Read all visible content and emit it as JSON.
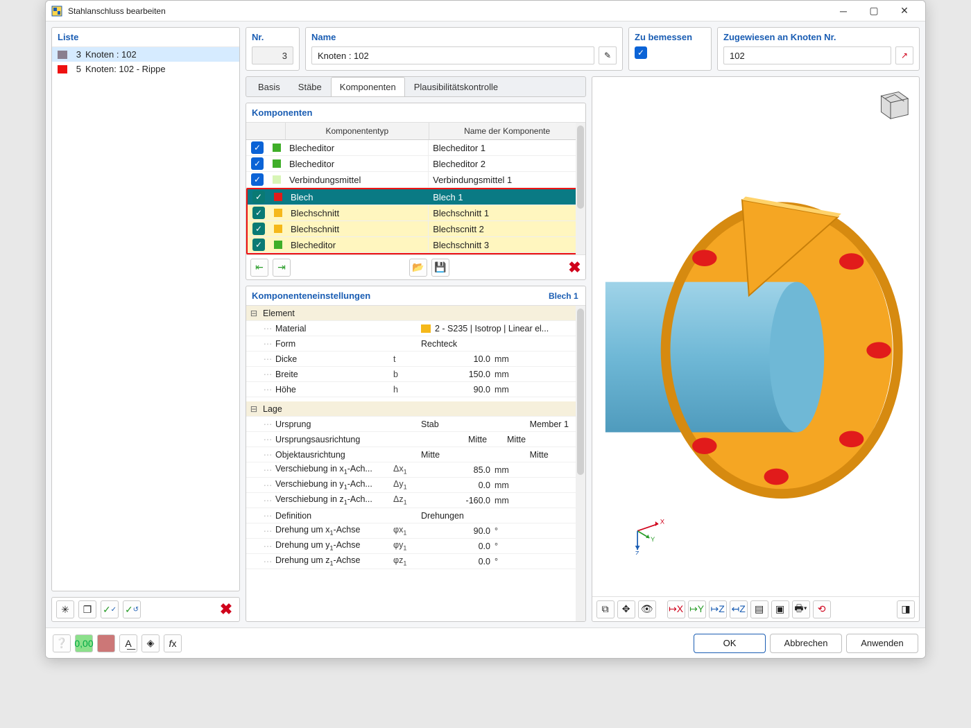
{
  "window": {
    "title": "Stahlanschluss bearbeiten"
  },
  "liste": {
    "title": "Liste",
    "items": [
      {
        "num": "3",
        "label": "Knoten : 102",
        "color": "#8a7f8f",
        "selected": true
      },
      {
        "num": "5",
        "label": "Knoten: 102 - Rippe",
        "color": "#e11",
        "selected": false
      }
    ]
  },
  "header": {
    "nr": {
      "title": "Nr.",
      "value": "3"
    },
    "name": {
      "title": "Name",
      "value": "Knoten : 102"
    },
    "zubemessen": {
      "title": "Zu bemessen",
      "checked": true
    },
    "zugewiesen": {
      "title": "Zugewiesen an Knoten Nr.",
      "value": "102"
    }
  },
  "tabs": [
    {
      "label": "Basis",
      "active": false
    },
    {
      "label": "Stäbe",
      "active": false
    },
    {
      "label": "Komponenten",
      "active": true
    },
    {
      "label": "Plausibilitätskontrolle",
      "active": false
    }
  ],
  "komponenten": {
    "title": "Komponenten",
    "headers": {
      "type": "Komponententyp",
      "name": "Name der Komponente"
    },
    "rows": [
      {
        "chk": "blue",
        "color": "#3fae29",
        "type": "Blecheditor",
        "name": "Blecheditor 1",
        "hl": false,
        "sel": false
      },
      {
        "chk": "blue",
        "color": "#3fae29",
        "type": "Blecheditor",
        "name": "Blecheditor 2",
        "hl": false,
        "sel": false
      },
      {
        "chk": "blue",
        "color": "#d8f5b6",
        "type": "Verbindungsmittel",
        "name": "Verbindungsmittel 1",
        "hl": false,
        "sel": false
      },
      {
        "chk": "teal",
        "color": "#e11b1b",
        "type": "Blech",
        "name": "Blech 1",
        "hl": true,
        "sel": true
      },
      {
        "chk": "teal",
        "color": "#f5b81a",
        "type": "Blechschnitt",
        "name": "Blechschnitt 1",
        "hl": true,
        "sel": false
      },
      {
        "chk": "teal",
        "color": "#f5b81a",
        "type": "Blechschnitt",
        "name": "Blechscnitt 2",
        "hl": true,
        "sel": false
      },
      {
        "chk": "teal",
        "color": "#3fae29",
        "type": "Blecheditor",
        "name": "Blechschnitt 3",
        "hl": true,
        "sel": false
      }
    ]
  },
  "settings": {
    "title": "Komponenteneinstellungen",
    "selected": "Blech 1",
    "groups": [
      {
        "label": "Element",
        "rows": [
          {
            "label": "Material",
            "sym": "",
            "val_text": "2 - S235 | Isotrop | Linear el...",
            "swatch": "#f5b81a"
          },
          {
            "label": "Form",
            "sym": "",
            "val_text": "Rechteck"
          },
          {
            "label": "Dicke",
            "sym": "t",
            "val": "10.0",
            "unit": "mm"
          },
          {
            "label": "Breite",
            "sym": "b",
            "val": "150.0",
            "unit": "mm"
          },
          {
            "label": "Höhe",
            "sym": "h",
            "val": "90.0",
            "unit": "mm"
          }
        ]
      },
      {
        "label": "Lage",
        "rows": [
          {
            "label": "Ursprung",
            "sym": "",
            "val_text": "Stab",
            "extra": "Member 1"
          },
          {
            "label": "Ursprungsausrichtung",
            "sym": "",
            "mid": "Mitte",
            "right": "Mitte"
          },
          {
            "label": "Objektausrichtung",
            "sym": "",
            "val_text": "Mitte",
            "extra": "Mitte"
          },
          {
            "label": "Verschiebung in x₁-Ach...",
            "sym": "Δx₁",
            "val": "85.0",
            "unit": "mm"
          },
          {
            "label": "Verschiebung in y₁-Ach...",
            "sym": "Δy₁",
            "val": "0.0",
            "unit": "mm"
          },
          {
            "label": "Verschiebung in z₁-Ach...",
            "sym": "Δz₁",
            "val": "-160.0",
            "unit": "mm"
          },
          {
            "label": "Definition",
            "sym": "",
            "val_text": "Drehungen"
          },
          {
            "label": "Drehung um x₁-Achse",
            "sym": "φx₁",
            "val": "90.0",
            "unit": "°"
          },
          {
            "label": "Drehung um y₁-Achse",
            "sym": "φy₁",
            "val": "0.0",
            "unit": "°"
          },
          {
            "label": "Drehung um z₁-Achse",
            "sym": "φz₁",
            "val": "0.0",
            "unit": "°"
          }
        ]
      }
    ]
  },
  "axes": {
    "x": "X",
    "y": "Y",
    "z": "Z"
  },
  "footer": {
    "ok": "OK",
    "cancel": "Abbrechen",
    "apply": "Anwenden"
  }
}
